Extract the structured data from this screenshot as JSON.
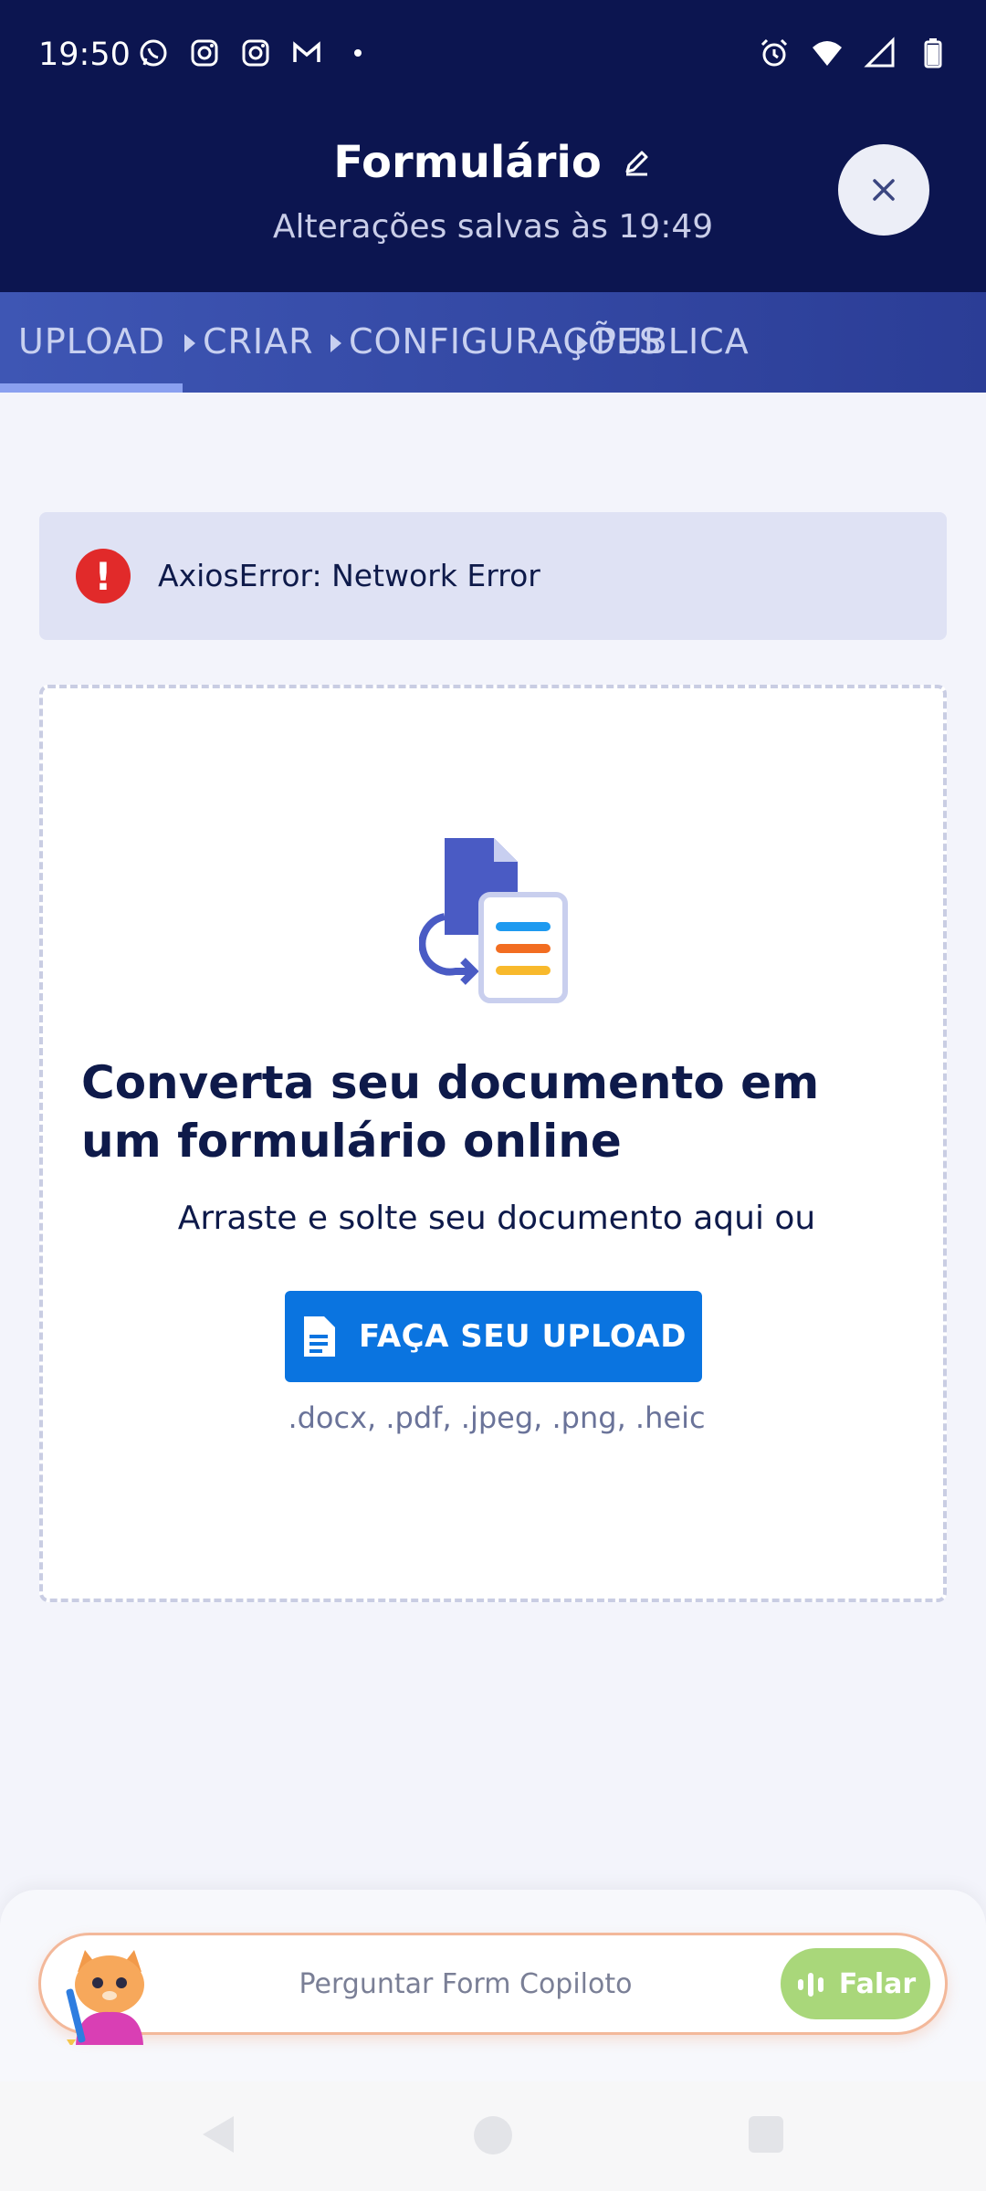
{
  "status_bar": {
    "time": "19:50",
    "left_icons": [
      "whatsapp-icon",
      "instagram-icon",
      "instagram-icon",
      "gmail-icon",
      "dot-icon"
    ],
    "right_icons": [
      "alarm-icon",
      "wifi-icon",
      "signal-icon",
      "battery-icon"
    ]
  },
  "header": {
    "title": "Formulário",
    "subtitle": "Alterações salvas às 19:49",
    "close_icon": "close-icon",
    "edit_icon": "pencil-icon"
  },
  "tabs": [
    {
      "label": "UPLOAD",
      "active": true
    },
    {
      "label": "CRIAR",
      "active": false
    },
    {
      "label": "CONFIGURAÇÕES",
      "active": false
    },
    {
      "label": "PUBLICA",
      "active": false
    }
  ],
  "error": {
    "message": "AxiosError: Network Error",
    "icon": "error-icon"
  },
  "dropzone": {
    "title": "Converta seu documento em um formulário online",
    "subtitle": "Arraste e solte seu documento aqui ou",
    "button_label": "FAÇA SEU UPLOAD",
    "formats": ".docx, .pdf, .jpeg, .png, .heic"
  },
  "copilot": {
    "placeholder": "Perguntar Form Copiloto",
    "speak_label": "Falar"
  },
  "colors": {
    "header_bg": "#0c1550",
    "accent": "#0a74e0",
    "error": "#e12a2a",
    "speak": "#a9d77a"
  }
}
